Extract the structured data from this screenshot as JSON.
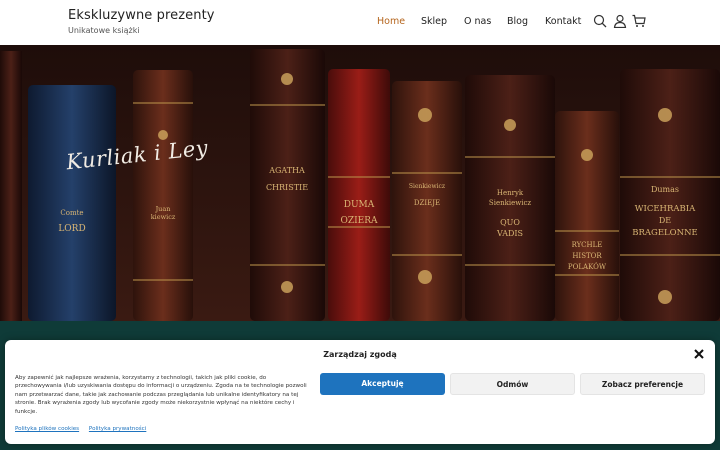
{
  "header": {
    "site_title": "Ekskluzywne prezenty",
    "tagline": "Unikatowe książki"
  },
  "nav": {
    "items": [
      {
        "label": "Home",
        "active": true
      },
      {
        "label": "Sklep",
        "active": false
      },
      {
        "label": "O nas",
        "active": false
      },
      {
        "label": "Blog",
        "active": false
      },
      {
        "label": "Kontakt",
        "active": false
      }
    ],
    "icons": [
      "search-icon",
      "user-icon",
      "cart-icon"
    ],
    "active_color": "#b5651d"
  },
  "hero": {
    "logo_text": "Kurliak i Ley",
    "book_spines": [
      {
        "lines": [
          "Comte",
          "LORD",
          "RD"
        ]
      },
      {
        "lines": [
          "Juan",
          "kiewicz"
        ]
      },
      {
        "lines": [
          "AGATHA",
          "CHRISTIE"
        ]
      },
      {
        "lines": [
          "DUMA",
          "OZIERA"
        ]
      },
      {
        "lines": [
          "Sienkiewicz",
          "DZIEJE"
        ]
      },
      {
        "lines": [
          "Henryk",
          "Sienkiewicz",
          "QUO",
          "VADIS"
        ]
      },
      {
        "lines": [
          "RYCHLE",
          "HISTOR",
          "POLAKÓW"
        ]
      },
      {
        "lines": [
          "Dumas",
          "WICEHRABIA",
          "DE",
          "BRAGELONNE"
        ]
      }
    ]
  },
  "consent": {
    "title": "Zarządzaj zgodą",
    "text": "Aby zapewnić jak najlepsze wrażenia, korzystamy z technologii, takich jak pliki cookie, do przechowywania i/lub uzyskiwania dostępu do informacji o urządzeniu. Zgoda na te technologie pozwoli nam przetwarzać dane, takie jak zachowanie podczas przeglądania lub unikalne identyfikatory na tej stronie. Brak wyrażenia zgody lub wycofanie zgody może niekorzystnie wpłynąć na niektóre cechy i funkcje.",
    "accept_label": "Akceptuję",
    "deny_label": "Odmów",
    "prefs_label": "Zobacz preferencje",
    "links": [
      "Polityka plików cookies",
      "Polityka prywatności"
    ],
    "accent_color": "#1e73be"
  }
}
